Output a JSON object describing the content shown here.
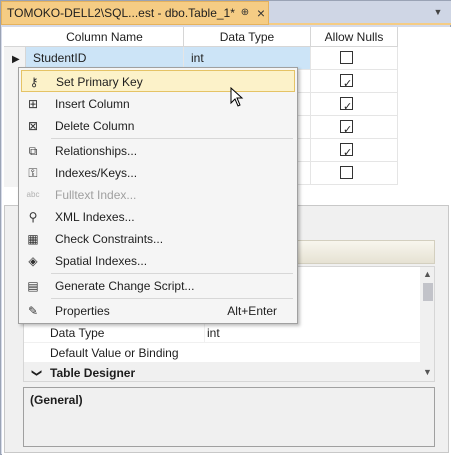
{
  "tab": {
    "title": "TOMOKO-DELL2\\SQL...est - dbo.Table_1*",
    "pin_glyph": "⊕",
    "close_glyph": "×",
    "dropdown_glyph": "▼"
  },
  "grid": {
    "columns": [
      "Column Name",
      "Data Type",
      "Allow Nulls"
    ],
    "rows": [
      {
        "name": "StudentID",
        "type": "int",
        "allow_nulls": false
      },
      {
        "name": "",
        "type": "",
        "allow_nulls": true
      },
      {
        "name": "",
        "type": "",
        "allow_nulls": true
      },
      {
        "name": "",
        "type": "",
        "allow_nulls": true
      },
      {
        "name": "",
        "type": "",
        "allow_nulls": true
      },
      {
        "name": "",
        "type": "",
        "allow_nulls": false
      }
    ]
  },
  "context_menu": {
    "items": [
      {
        "label": "Set Primary Key",
        "icon": "key-icon",
        "glyph": "⚷",
        "hover": true
      },
      {
        "label": "Insert Column",
        "icon": "insert-column-icon",
        "glyph": "⊞"
      },
      {
        "label": "Delete Column",
        "icon": "delete-column-icon",
        "glyph": "⊠"
      },
      {
        "label": "Relationships...",
        "icon": "relationships-icon",
        "glyph": "⧉"
      },
      {
        "label": "Indexes/Keys...",
        "icon": "indexes-icon",
        "glyph": "⚿"
      },
      {
        "label": "Fulltext Index...",
        "icon": "fulltext-icon",
        "glyph": "abc",
        "disabled": true
      },
      {
        "label": "XML Indexes...",
        "icon": "xml-indexes-icon",
        "glyph": "⚲"
      },
      {
        "label": "Check Constraints...",
        "icon": "check-constraints-icon",
        "glyph": "▦"
      },
      {
        "label": "Spatial Indexes...",
        "icon": "spatial-indexes-icon",
        "glyph": "◈"
      },
      {
        "label": "Generate Change Script...",
        "icon": "script-icon",
        "glyph": "▤"
      },
      {
        "label": "Properties",
        "icon": "wrench-icon",
        "glyph": "✎",
        "shortcut": "Alt+Enter"
      }
    ]
  },
  "properties": {
    "rows": [
      {
        "name": "Data Type",
        "value": "int"
      },
      {
        "name": "Default Value or Binding",
        "value": ""
      }
    ],
    "category": "Table Designer",
    "category_caret": "❯"
  },
  "description": {
    "title": "(General)"
  },
  "colors": {
    "tab_active": "#f5cc84",
    "selection": "#cce4f7",
    "menu_hover": "#fcf2c9"
  }
}
